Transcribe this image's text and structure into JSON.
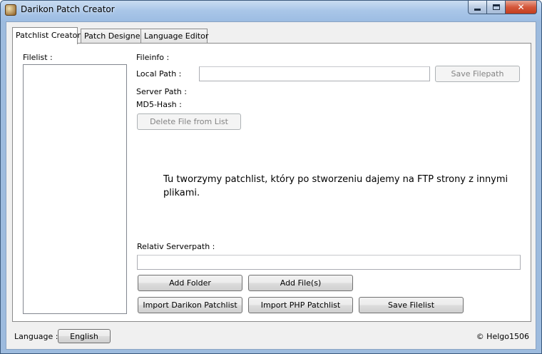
{
  "window": {
    "title": "Darikon Patch Creator",
    "close_glyph": "✕"
  },
  "tabs": [
    {
      "label": "Patchlist Creator",
      "active": true
    },
    {
      "label": "Patch Designer",
      "active": false
    },
    {
      "label": "Language Editor",
      "active": false
    }
  ],
  "patchlist": {
    "filelist_label": "Filelist :",
    "fileinfo_label": "Fileinfo :",
    "local_path_label": "Local Path :",
    "local_path_value": "",
    "save_filepath_label": "Save Filepath",
    "server_path_label": "Server Path :",
    "md5_label": "MD5-Hash :",
    "delete_file_label": "Delete File from List",
    "info_text": "Tu tworzymy patchlist, który po stworzeniu dajemy na FTP strony z innymi plikami.",
    "relative_serverpath_label": "Relativ Serverpath :",
    "relative_serverpath_value": "",
    "add_folder_label": "Add Folder",
    "add_files_label": "Add File(s)",
    "import_darikon_label": "Import Darikon Patchlist",
    "import_php_label": "Import PHP Patchlist",
    "save_filelist_label": "Save Filelist"
  },
  "footer": {
    "language_label": "Language :",
    "language_button": "English",
    "copyright": "© Helgo1506"
  },
  "icons": {
    "app": "darikon-app-icon",
    "minimize": "minimize-icon",
    "maximize": "maximize-icon",
    "close": "close-icon"
  },
  "colors": {
    "titlebar": "#a9c6e8",
    "close_button": "#c23d1e",
    "client_background": "#f0f0f0"
  }
}
